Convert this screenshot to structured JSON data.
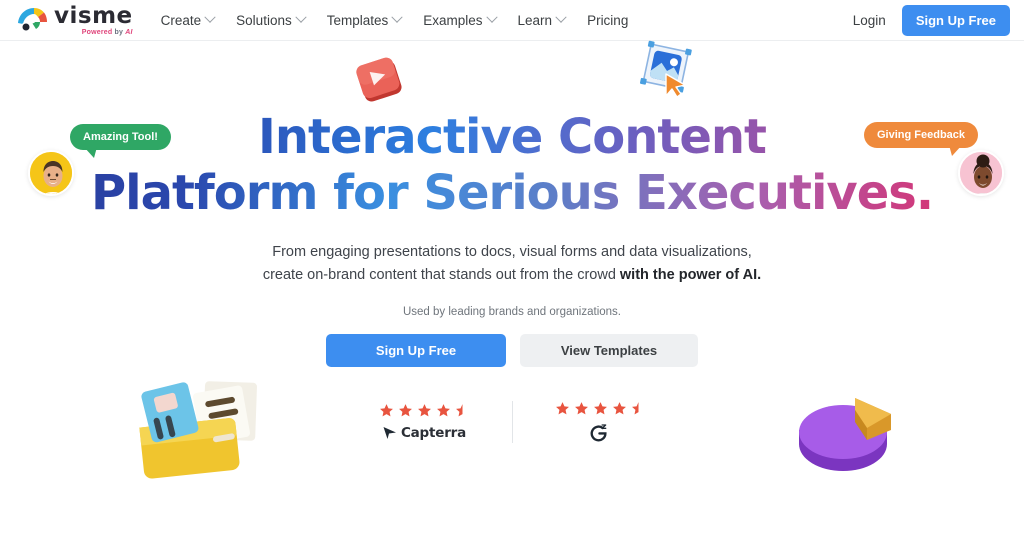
{
  "brand": {
    "name": "visme",
    "tagline_powered": "Powered",
    "tagline_by": "by",
    "tagline_ai": "AI",
    "logo_icon": "visme-fan-logo-icon"
  },
  "nav": {
    "items": [
      {
        "label": "Create",
        "has_dropdown": true,
        "icon": "chevron-down-icon"
      },
      {
        "label": "Solutions",
        "has_dropdown": true,
        "icon": "chevron-down-icon"
      },
      {
        "label": "Templates",
        "has_dropdown": true,
        "icon": "chevron-down-icon"
      },
      {
        "label": "Examples",
        "has_dropdown": true,
        "icon": "chevron-down-icon"
      },
      {
        "label": "Learn",
        "has_dropdown": true,
        "icon": "chevron-down-icon"
      },
      {
        "label": "Pricing",
        "has_dropdown": false,
        "icon": ""
      }
    ],
    "login_label": "Login",
    "signup_label": "Sign Up Free"
  },
  "hero": {
    "headline_line1": "Interactive Content",
    "headline_line2": "Platform for Serious Executives.",
    "subtitle_line1": "From engaging presentations to docs, visual forms and data visualizations,",
    "subtitle_line2_normal": "create on-brand content that stands out from the crowd ",
    "subtitle_line2_bold": "with the power of AI.",
    "used_by": "Used by leading brands and organizations.",
    "cta_primary": "Sign Up Free",
    "cta_secondary": "View Templates"
  },
  "testimonials": [
    {
      "text": "Amazing Tool!",
      "color": "#2fa765",
      "avatar": "avatar-man-yellow",
      "side": "left"
    },
    {
      "text": "Giving Feedback",
      "color": "#ef8a3c",
      "avatar": "avatar-woman-pink",
      "side": "right"
    }
  ],
  "ratings": [
    {
      "brand": "Capterra",
      "stars": 4.5,
      "icon": "capterra-arrow-icon",
      "star_color": "#e8543f"
    },
    {
      "brand": "",
      "stars": 4.5,
      "icon": "g2-logo-icon",
      "star_color": "#e8543f"
    }
  ],
  "decorations": [
    {
      "name": "video-play-tile-3d",
      "color": "#e8615c"
    },
    {
      "name": "image-select-tile-3d",
      "color": "#2b6fd8"
    },
    {
      "name": "folder-documents-3d",
      "color": "#f3cb3c"
    },
    {
      "name": "pie-chart-3d",
      "color": "#9b51e0"
    }
  ],
  "colors": {
    "accent_blue": "#3d8ef0",
    "star_orange": "#e8543f",
    "bubble_green": "#2fa765",
    "bubble_orange": "#ef8a3c",
    "headline_start": "#28348a",
    "headline_end": "#e8215c"
  }
}
